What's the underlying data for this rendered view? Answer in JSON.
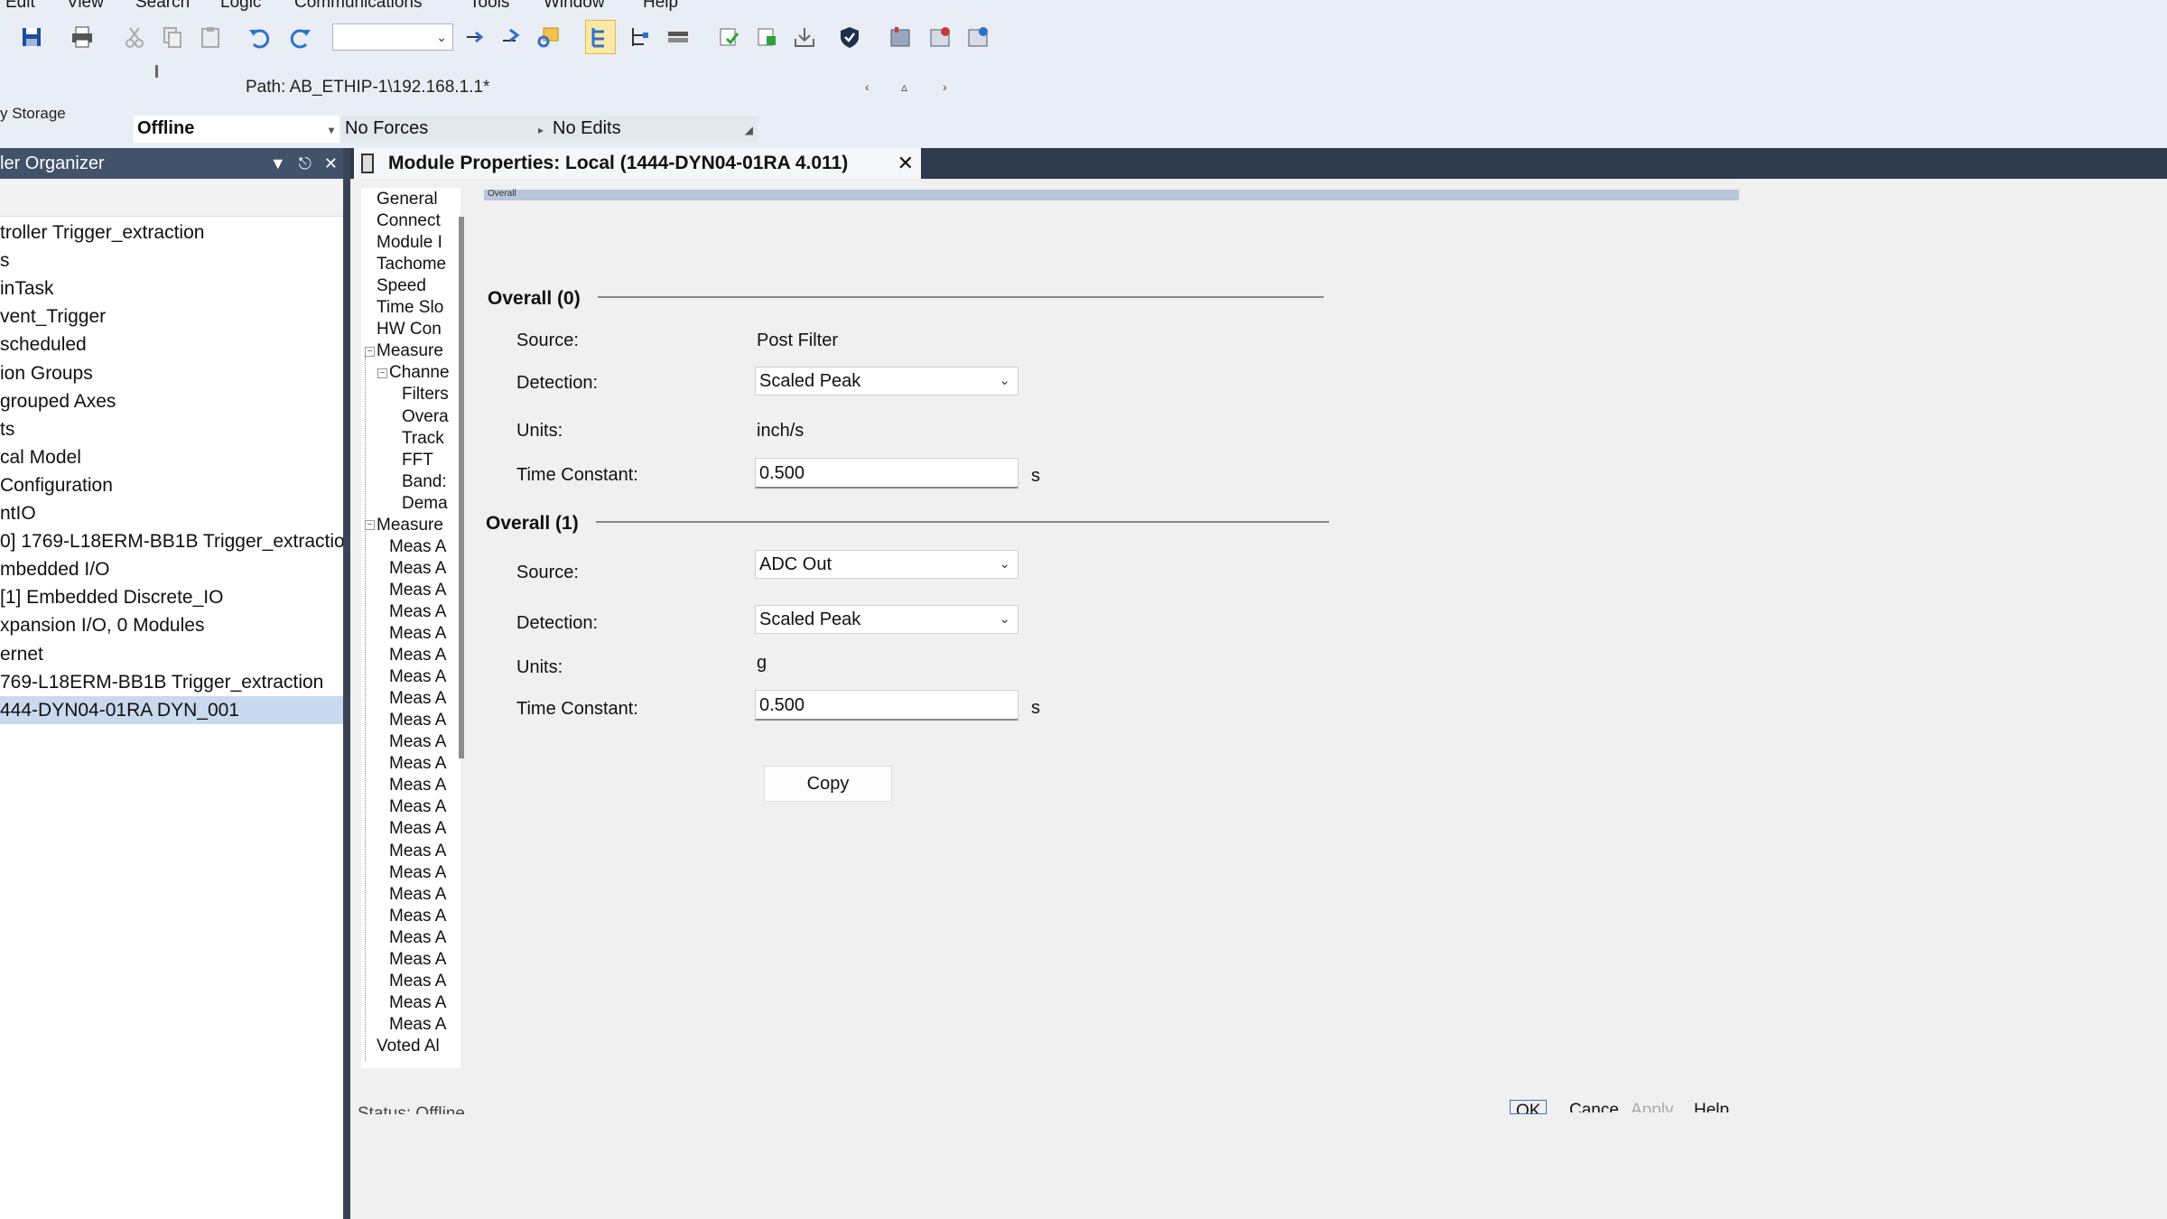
{
  "menu": [
    "Edit",
    "View",
    "Search",
    "Logic",
    "Communications",
    "Tools",
    "Window",
    "Help"
  ],
  "toolbar": {
    "icons": [
      "save-icon",
      "print-icon",
      "cut-icon",
      "copy-icon",
      "paste-icon",
      "undo-icon",
      "redo-icon",
      "step-icon",
      "step-out-icon",
      "crossref-icon",
      "ladder-icon",
      "tree-icon",
      "stack-icon",
      "verify-icon",
      "download-icon",
      "upload-icon",
      "shield-icon",
      "module-icon",
      "config-icon",
      "config2-icon"
    ],
    "combo_value": ""
  },
  "path": "Path:  AB_ETHIP-1\\192.168.1.1*",
  "storage_label": "y Storage",
  "status_fields": {
    "mode": "Offline",
    "forces": "No Forces",
    "edits": "No Edits"
  },
  "organizer": {
    "title": "ler Organizer",
    "items": [
      "troller Trigger_extraction",
      "s",
      "inTask",
      "vent_Trigger",
      "scheduled",
      "ion Groups",
      "grouped Axes",
      "ts",
      "cal Model",
      "Configuration",
      "ntIO",
      "0] 1769-L18ERM-BB1B Trigger_extractio",
      "mbedded I/O",
      "[1] Embedded Discrete_IO",
      "xpansion I/O, 0 Modules",
      "ernet",
      "769-L18ERM-BB1B Trigger_extraction",
      "444-DYN04-01RA DYN_001"
    ]
  },
  "doc_tab": {
    "title": "Module Properties: Local (1444-DYN04-01RA 4.011)"
  },
  "nav": {
    "items": [
      "General",
      "Connect",
      "Module I",
      "Tachome",
      "Speed",
      "Time Slo",
      "HW Con",
      "Measure",
      "Channe",
      "Filters",
      "Overa",
      "Track",
      "FFT",
      "Band:",
      "Dema",
      "Measure",
      "Meas A",
      "Meas A",
      "Meas A",
      "Meas A",
      "Meas A",
      "Meas A",
      "Meas A",
      "Meas A",
      "Meas A",
      "Meas A",
      "Meas A",
      "Meas A",
      "Meas A",
      "Meas A",
      "Meas A",
      "Meas A",
      "Meas A",
      "Meas A",
      "Meas A",
      "Meas A",
      "Meas A",
      "Meas A",
      "Meas A",
      "Voted Al"
    ]
  },
  "page_caption": "Overall",
  "overall0": {
    "header": "Overall (0)",
    "source_label": "Source:",
    "source": "Post Filter",
    "detection_label": "Detection:",
    "detection": "Scaled Peak",
    "units_label": "Units:",
    "units": "inch/s",
    "tc_label": "Time Constant:",
    "tc": "0.500",
    "tc_unit": "s"
  },
  "overall1": {
    "header": "Overall (1)",
    "source_label": "Source:",
    "source": "ADC Out",
    "detection_label": "Detection:",
    "detection": "Scaled Peak",
    "units_label": "Units:",
    "units": "g",
    "tc_label": "Time Constant:",
    "tc": "0.500",
    "tc_unit": "s"
  },
  "copy_label": "Copy",
  "status": "Status:  Offline",
  "buttons": {
    "ok": "OK",
    "cancel": "Cance",
    "apply": "Apply",
    "help": "Help"
  }
}
